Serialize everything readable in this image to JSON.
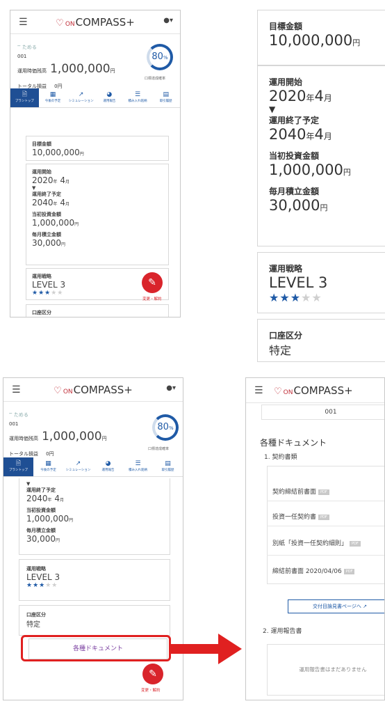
{
  "brand": {
    "on": "ON",
    "name": "COMPASS+"
  },
  "phone": {
    "goal_name": "ためる",
    "account_no": "001",
    "balance_label": "運用時価残高",
    "balance_value": "1,000,000",
    "balance_unit": "円",
    "total_label": "トータル損益",
    "total_value": "0",
    "total_unit": "円",
    "progress_percent": 80,
    "progress_text": "80",
    "progress_unit": "%",
    "progress_caption": "口標達成確率"
  },
  "tabs": [
    {
      "icon": "document-icon",
      "glyph": "🗎",
      "label": "プラントップ",
      "active": true
    },
    {
      "icon": "calendar-icon",
      "glyph": "▦",
      "label": "今後の予定",
      "active": false
    },
    {
      "icon": "chart-icon",
      "glyph": "↗",
      "label": "シミュレーション",
      "active": false
    },
    {
      "icon": "pie-icon",
      "glyph": "◕",
      "label": "運用報告",
      "active": false
    },
    {
      "icon": "list-icon",
      "glyph": "☰",
      "label": "積み入れ銘柄",
      "active": false
    },
    {
      "icon": "book-icon",
      "glyph": "▤",
      "label": "取引履歴",
      "active": false
    }
  ],
  "plan": {
    "goal_amount_label": "目標金額",
    "goal_amount_value": "10,000,000",
    "goal_amount_unit": "円",
    "start_label": "運用開始",
    "start_year": "2020",
    "start_month": "4",
    "end_label": "運用終了予定",
    "end_year": "2040",
    "end_month": "4",
    "year_unit": "年",
    "month_unit": "月",
    "arrow": "▼",
    "initial_label": "当初投資金額",
    "initial_value": "1,000,000",
    "initial_unit": "円",
    "monthly_label": "毎月積立金額",
    "monthly_value": "30,000",
    "monthly_unit": "円",
    "strategy_label": "運用戦略",
    "strategy_value": "LEVEL 3",
    "strategy_stars": 3,
    "strategy_stars_max": 5,
    "account_type_label": "口座区分",
    "account_type_value": "特定"
  },
  "fab": {
    "icon": "pencil-icon",
    "glyph": "✎",
    "caption": "変更・解約"
  },
  "docs_button": {
    "label": "各種ドキュメント"
  },
  "docs": {
    "account_no": "001",
    "title": "各種ドキュメント",
    "section1": "1. 契約書類",
    "items": [
      {
        "label": "契約締結前書面",
        "badge": "PDF"
      },
      {
        "label": "投資一任契約書",
        "badge": "PDF"
      },
      {
        "label": "別紙「投資一任契約細則」",
        "badge": "PDF"
      },
      {
        "label": "締結前書面 2020/04/06",
        "badge": "PDF"
      }
    ],
    "delivery_button": "交付目論見書ページへ",
    "section2": "2. 運用報告書",
    "empty_note": "運用報告書はまだありません"
  },
  "colors": {
    "brand_red": "#c0303a",
    "accent_blue": "#1f5aa6",
    "fab_red": "#d9242b",
    "highlight_red": "#e02020"
  }
}
